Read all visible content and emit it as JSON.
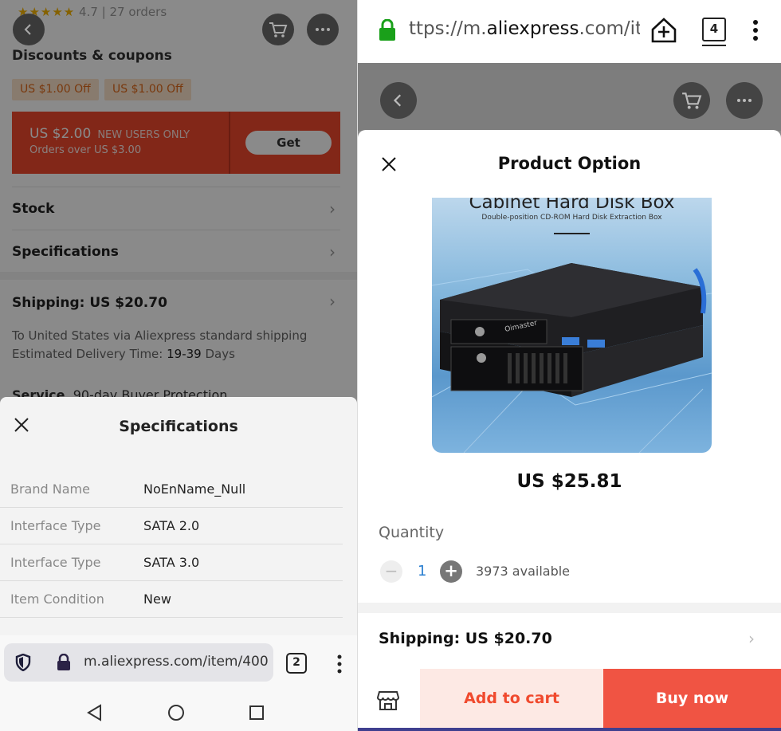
{
  "left": {
    "rating": "4.7 | 27 orders",
    "section_discounts": "Discounts & coupons",
    "coupons": [
      "US $1.00 Off",
      "US $1.00 Off"
    ],
    "banner": {
      "amount": "US $2.00",
      "tag": "NEW USERS ONLY",
      "min": "Orders over US $3.00",
      "get": "Get"
    },
    "rows": [
      "Stock",
      "Specifications"
    ],
    "shipping": "Shipping: US $20.70",
    "ship_line1": "To United States via Aliexpress standard shipping",
    "ship_line2_pre": "Estimated Delivery Time: ",
    "ship_days": "19-39",
    "ship_line2_post": " Days",
    "service_label": "Service",
    "service_value": "90-day Buyer Protection",
    "sheet_title": "Specifications",
    "specs": [
      {
        "k": "Brand Name",
        "v": "NoEnName_Null"
      },
      {
        "k": "Interface Type",
        "v": "SATA 2.0"
      },
      {
        "k": "Interface Type",
        "v": "SATA 3.0"
      },
      {
        "k": "Item Condition",
        "v": "New"
      }
    ],
    "url": "m.aliexpress.com/item/400",
    "tab_count": "2"
  },
  "right": {
    "url_prefix": "ttps://m.",
    "url_domain": "aliexpress",
    "url_suffix": ".com/ite",
    "tab_count": "4",
    "sheet_title": "Product Option",
    "image_heading": "Cabinet Hard Disk Box",
    "image_sub": "Double-position CD-ROM Hard Disk Extraction Box",
    "image_brand": "Oimaster",
    "price": "US $25.81",
    "quantity_label": "Quantity",
    "quantity_minus": "−",
    "quantity_plus": "+",
    "quantity": "1",
    "available": "3973 available",
    "shipping": "Shipping: US $20.70",
    "add_to_cart": "Add to cart",
    "buy_now": "Buy now"
  },
  "colors": {
    "accent": "#f05443",
    "coupon_bg": "#fbe3cc",
    "link_blue": "#2a7fd0"
  }
}
